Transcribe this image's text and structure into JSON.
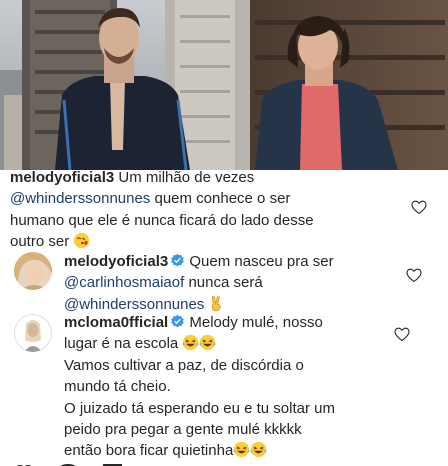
{
  "comments": [
    {
      "username": "melodyoficial3",
      "line1_rest": "Um milhão de vezes",
      "line2_mention": "@whinderssonnunes",
      "line2_rest": "quem conhece o ser",
      "line3": "humano que ele é nunca ficará do lado desse",
      "line4": "outro ser",
      "icons": [
        "kissing-face-emoji",
        "heart-icon"
      ]
    },
    {
      "username": "melodyoficial3",
      "line1_rest": "Quem nasceu pra ser",
      "line2_mention": "@carlinhosmaiaof",
      "line2_rest": "nunca será",
      "line3_mention": "@whinderssonnunes",
      "icons": [
        "avatar",
        "verified-badge-icon",
        "victory-hand-emoji",
        "heart-icon"
      ]
    },
    {
      "username": "mcloma0fficial",
      "line1_rest": "Melody mulé, nosso",
      "line2": "lugar é na escola",
      "line3": "Vamos cultivar a paz, de discórdia o",
      "line4": "mundo tá cheio.",
      "line5": "O juizado tá esperando eu e tu soltar um",
      "line6": "peido pra pegar a gente mulé kkkkk",
      "line7": "então bora ficar quietinha",
      "icons": [
        "avatar",
        "verified-badge-icon",
        "laughing-tears-emoji",
        "heart-icon"
      ]
    }
  ],
  "colors": {
    "text": "#262626",
    "mention": "#1f3d6e",
    "verified": "#3897f0",
    "heart_outline": "#262626"
  }
}
